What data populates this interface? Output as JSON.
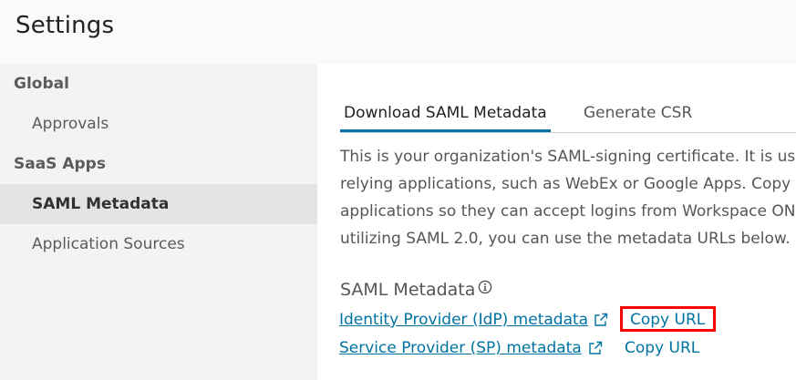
{
  "page": {
    "title": "Settings"
  },
  "sidebar": {
    "sections": [
      {
        "label": "Global",
        "items": [
          {
            "label": "Approvals",
            "active": false
          }
        ]
      },
      {
        "label": "SaaS Apps",
        "items": [
          {
            "label": "SAML Metadata",
            "active": true
          },
          {
            "label": "Application Sources",
            "active": false
          }
        ]
      }
    ]
  },
  "tabs": [
    {
      "label": "Download SAML Metadata",
      "active": true
    },
    {
      "label": "Generate CSR",
      "active": false
    }
  ],
  "description_lines": [
    "This is your organization's SAML-signing certificate. It is used",
    "relying applications, such as WebEx or Google Apps. Copy a",
    "applications so they can accept logins from Workspace ONE",
    "utilizing SAML 2.0, you can use the metadata URLs below."
  ],
  "saml_metadata": {
    "title": "SAML Metadata",
    "info_icon": "info-icon",
    "rows": [
      {
        "link_label": "Identity Provider (IdP) metadata",
        "copy_label": "Copy URL",
        "icon": "external-link-icon"
      },
      {
        "link_label": "Service Provider (SP) metadata",
        "copy_label": "Copy URL",
        "icon": "external-link-icon"
      }
    ]
  },
  "colors": {
    "link": "#0072a3",
    "highlight": "#ff0000",
    "sidebar_bg": "#f3f3f3",
    "active_item_bg": "#e4e4e4"
  }
}
